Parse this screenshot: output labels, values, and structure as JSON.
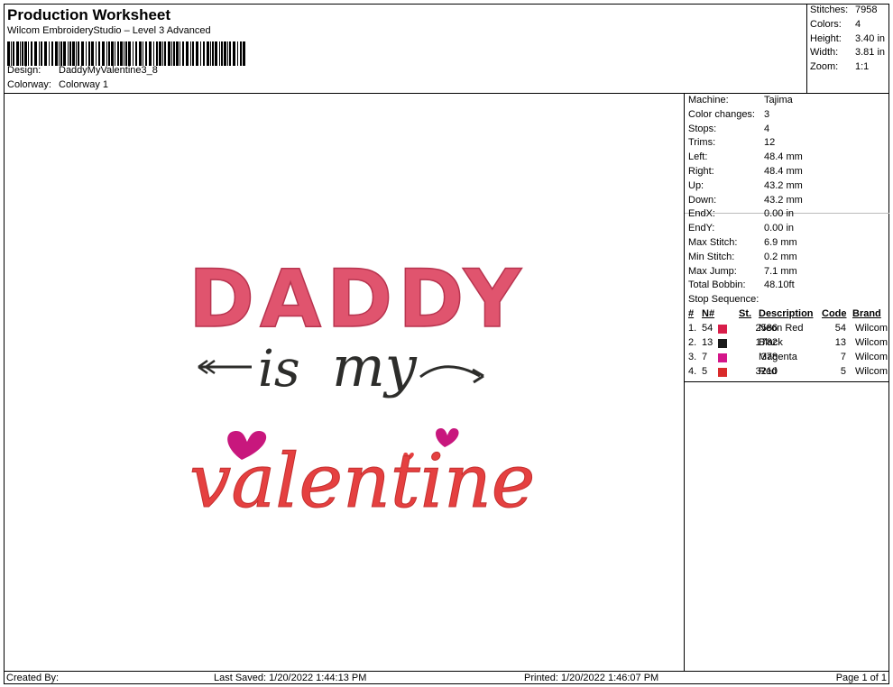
{
  "header": {
    "title": "Production Worksheet",
    "software": "Wilcom EmbroideryStudio – Level 3 Advanced",
    "design_label": "Design:",
    "design_value": "DaddyMyValentine3_8",
    "colorway_label": "Colorway:",
    "colorway_value": "Colorway 1"
  },
  "summary": {
    "stitches_label": "Stitches:",
    "stitches": "7958",
    "colors_label": "Colors:",
    "colors": "4",
    "height_label": "Height:",
    "height": "3.40 in",
    "width_label": "Width:",
    "width": "3.81 in",
    "zoom_label": "Zoom:",
    "zoom": "1:1"
  },
  "details": [
    {
      "k": "Machine:",
      "v": "Tajima"
    },
    {
      "k": "Color changes:",
      "v": "3"
    },
    {
      "k": "Stops:",
      "v": "4"
    },
    {
      "k": "Trims:",
      "v": "12"
    },
    {
      "k": "Left:",
      "v": "48.4 mm"
    },
    {
      "k": "Right:",
      "v": "48.4 mm"
    },
    {
      "k": "Up:",
      "v": "43.2 mm"
    },
    {
      "k": "Down:",
      "v": "43.2 mm"
    },
    {
      "k": "EndX:",
      "v": "0.00 in"
    },
    {
      "k": "EndY:",
      "v": "0.00 in"
    },
    {
      "k": "Max Stitch:",
      "v": "6.9 mm"
    },
    {
      "k": "Min Stitch:",
      "v": "0.2 mm"
    },
    {
      "k": "Max Jump:",
      "v": "7.1 mm"
    },
    {
      "k": "Total Bobbin:",
      "v": "48.10ft"
    }
  ],
  "stop_sequence": {
    "label": "Stop Sequence:",
    "headers": {
      "num": "#",
      "n": "N#",
      "st": "St.",
      "desc": "Description",
      "code": "Code",
      "brand": "Brand"
    },
    "rows": [
      {
        "num": "1.",
        "n": "54",
        "color": "#d81e4a",
        "st": "2586",
        "desc": "Neon Red",
        "code": "54",
        "brand": "Wilcom"
      },
      {
        "num": "2.",
        "n": "13",
        "color": "#1a1a1a",
        "st": "1782",
        "desc": "Black",
        "code": "13",
        "brand": "Wilcom"
      },
      {
        "num": "3.",
        "n": "7",
        "color": "#d4168a",
        "st": "378",
        "desc": "Magenta",
        "code": "7",
        "brand": "Wilcom"
      },
      {
        "num": "4.",
        "n": "5",
        "color": "#d92b2b",
        "st": "3210",
        "desc": "Red",
        "code": "5",
        "brand": "Wilcom"
      }
    ]
  },
  "design": {
    "line1": "DADDY",
    "line2a": "is",
    "line2b": "my",
    "line3": "valentine",
    "color1": "#e0546e",
    "color2": "#2d2d2b",
    "color3": "#e54040",
    "heart_color": "#c8177d"
  },
  "footer": {
    "created_by": "Created By:",
    "last_saved": "Last Saved: 1/20/2022 1:44:13 PM",
    "printed": "Printed: 1/20/2022 1:46:07 PM",
    "page": "Page 1 of 1"
  }
}
